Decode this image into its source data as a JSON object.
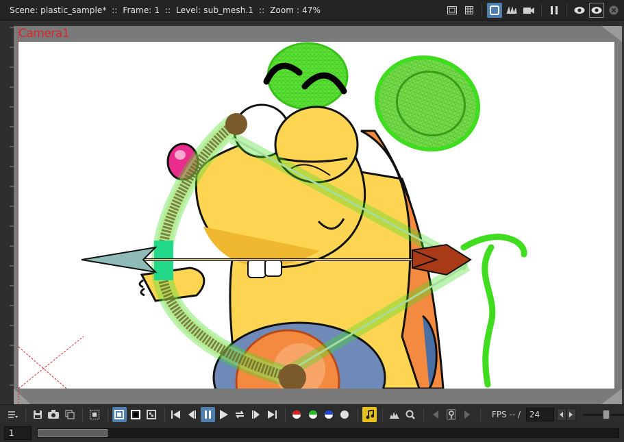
{
  "titlebar": {
    "text": "Scene: plastic_sample*  ::  Frame: 1  ::  Level: sub_mesh.1  ::  Zoom : 47%"
  },
  "title_icons": [
    "safe-area-icon",
    "field-guide-icon",
    "camera-stand-view-icon",
    "3d-view-icon",
    "camera-view-icon",
    "freeze-icon",
    "preview-icon",
    "sub-camera-preview-icon",
    "close-icon"
  ],
  "viewer": {
    "camera_label": "Camera1",
    "stage_color": "#7a7a7a",
    "paper_color": "#ffffff",
    "camera_color": "#d6282a"
  },
  "toolbar": {
    "fps_label": "FPS -- / ",
    "fps_value": "24",
    "zoom_level": 0.55,
    "accent": "#4f7fae"
  },
  "framebar": {
    "frame_value": "1",
    "frame_position": 0.12
  }
}
